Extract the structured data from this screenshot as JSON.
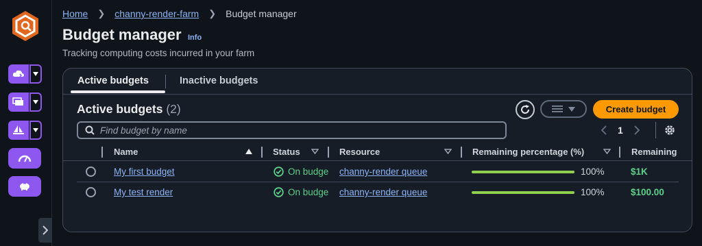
{
  "breadcrumb": {
    "home": "Home",
    "farm": "channy-render-farm",
    "current": "Budget manager"
  },
  "page": {
    "title": "Budget manager",
    "info": "Info",
    "subtitle": "Tracking computing costs incurred in your farm"
  },
  "tabs": {
    "active": "Active budgets",
    "inactive": "Inactive budgets"
  },
  "panel": {
    "title": "Active budgets",
    "count": "(2)",
    "create_label": "Create budget"
  },
  "search": {
    "placeholder": "Find budget by name",
    "value": ""
  },
  "pager": {
    "current_page": "1"
  },
  "table": {
    "headers": [
      "Name",
      "Status",
      "Resource",
      "Remaining percentage (%)",
      "Remaining"
    ],
    "rows": [
      {
        "name": "My first budget",
        "status": "On budge",
        "resource": "channy-render queue",
        "percent_text": "100%",
        "percent": 100,
        "remaining": "$1K"
      },
      {
        "name": "My test render",
        "status": "On budge",
        "resource": "channy-render queue",
        "percent_text": "100%",
        "percent": 100,
        "remaining": "$100.00"
      }
    ]
  },
  "colors": {
    "accent": "#8e58f0",
    "primary_button": "#ff9900",
    "link": "#8db3f5",
    "success": "#5fd08a",
    "progress": "#8fd14f"
  },
  "icons": [
    "deadline-cloud-logo-icon",
    "farm-icon",
    "queue-icon",
    "fleet-icon",
    "dashboard-icon",
    "budget-piggybank-icon",
    "refresh-icon",
    "list-settings-icon",
    "search-icon",
    "settings-gear-icon",
    "sort-icon",
    "success-check-icon"
  ]
}
